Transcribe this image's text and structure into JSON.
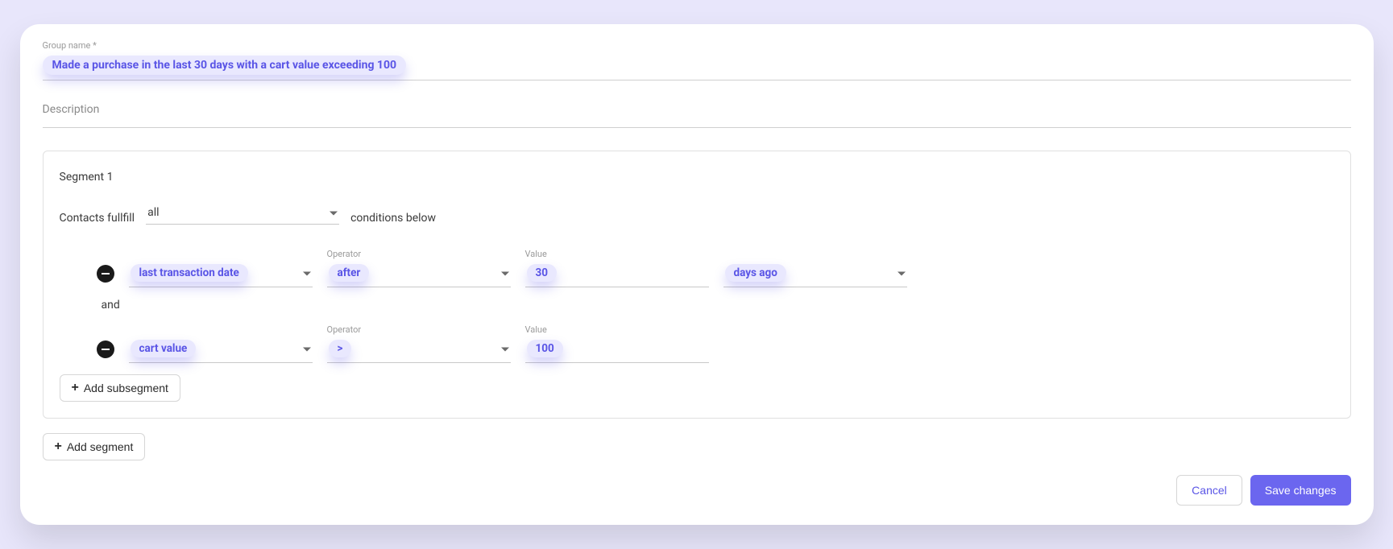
{
  "groupName": {
    "label": "Group name *",
    "value": "Made a purchase in the last 30 days with a cart value exceeding 100"
  },
  "description": {
    "placeholder": "Description",
    "value": ""
  },
  "segment": {
    "title": "Segment 1",
    "fulfill": {
      "prefix": "Contacts fullfill",
      "mode": "all",
      "suffix": "conditions below"
    },
    "conditions": [
      {
        "attribute": "last transaction date",
        "operatorLabel": "Operator",
        "operator": "after",
        "valueLabel": "Value",
        "value": "30",
        "unit": "days ago"
      },
      {
        "attribute": "cart value",
        "operatorLabel": "Operator",
        "operator": ">",
        "valueLabel": "Value",
        "value": "100",
        "unit": null
      }
    ],
    "joiner": "and",
    "addSubsegment": "Add subsegment"
  },
  "addSegment": "Add segment",
  "actions": {
    "cancel": "Cancel",
    "save": "Save changes"
  }
}
